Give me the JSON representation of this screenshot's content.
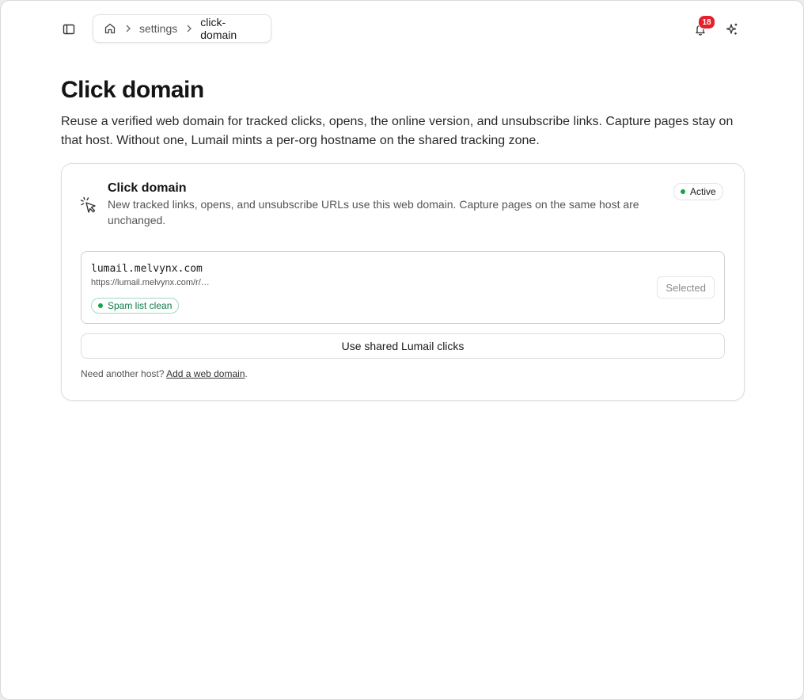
{
  "header": {
    "breadcrumb": {
      "items": [
        "settings",
        "click-domain"
      ]
    },
    "notifications": {
      "count": "18"
    }
  },
  "page": {
    "title": "Click domain",
    "description": "Reuse a verified web domain for tracked clicks, opens, the online version, and unsubscribe links. Capture pages stay on that host. Without one, Lumail mints a per-org hostname on the shared tracking zone."
  },
  "card": {
    "title": "Click domain",
    "description": "New tracked links, opens, and unsubscribe URLs use this web domain. Capture pages on the same host are unchanged.",
    "status": "Active",
    "domain": {
      "host": "lumail.melvynx.com",
      "url": "https://lumail.melvynx.com/r/…",
      "spam_status": "Spam list clean",
      "selected_label": "Selected"
    },
    "shared_button": "Use shared Lumail clicks",
    "footer_prefix": "Need another host?",
    "footer_link": "Add a web domain",
    "footer_suffix": "."
  },
  "colors": {
    "accent_green": "#16a34a",
    "badge_red": "#e5202b"
  }
}
